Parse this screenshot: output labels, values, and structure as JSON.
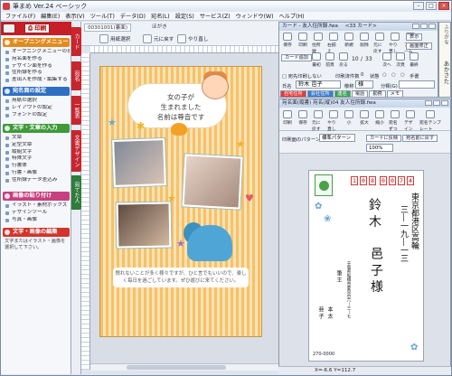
{
  "window": {
    "title": "筆まめ Ver.24 ベーシック"
  },
  "menu": [
    "ファイル(F)",
    "編集(E)",
    "表示(V)",
    "ツール(T)",
    "データ(D)",
    "宛名(L)",
    "設定(S)",
    "サービス(Z)",
    "ウィンドウ(W)",
    "ヘルプ(H)"
  ],
  "left": {
    "print_label": "印刷",
    "sections": [
      {
        "title": "オープニングメニュー",
        "items": [
          "オープニングメニューの表示",
          "宛名面を作る",
          "デザイン面を作る",
          "住所録を作る",
          "差出人を作成・編集する"
        ]
      },
      {
        "title": "宛名面の設定",
        "items": [
          "用紙の選択",
          "レイアウトの設定",
          "フォントの設定"
        ]
      },
      {
        "title": "文字・文章の入力",
        "items": [
          "文章",
          "定型文章",
          "縦組文字",
          "特殊文字",
          "行書体",
          "行書・画像",
          "住所録データ差込み"
        ]
      },
      {
        "title": "画像の貼り付け",
        "items": [
          "イラスト・素材ボックス",
          "デザインツール",
          "写真・画像"
        ]
      },
      {
        "title": "文字・画像の編集",
        "items": []
      }
    ],
    "note": "文字またはイラスト・画像を選択して下さい。"
  },
  "vtabs": [
    "カード",
    "宛名",
    "一覧表",
    "文書デザイン",
    "宛てた人"
  ],
  "doc": {
    "tab1": "00301001(裏面)",
    "tab2": "ほがき",
    "btn_paper": "用紙選択",
    "btn_undo": "元に戻す",
    "btn_redo": "やり直し",
    "card_text": "女の子が\n生まれました\n名前は尊音です",
    "bottom_text": "慣れないことが多く様々ですが、ひと言でもいいので、楽しく毎日を過ごしています。ぜひ遊びに来てください。"
  },
  "cardwin": {
    "title": "カード - 友人住所録.fwa",
    "count_label": "<33 カード>",
    "index": "10",
    "total": "33",
    "top_row": [
      "保存",
      "印刷",
      "住所録",
      "右揃え",
      "新規",
      "削除",
      "元に戻す",
      "やり直し",
      "フォーム"
    ],
    "nav_row": [
      "最初",
      "前頁",
      "戻る",
      "次へ",
      "次頁",
      "最終"
    ],
    "btn_add": "カード追加",
    "btn_display": "表示",
    "btn_fix": "画面修正",
    "print_toggle": "宛先印刷しない",
    "printed_label": "印刷済件数",
    "printed_value": "0",
    "state_label": "状態",
    "state_options": [
      "○",
      "○",
      "○",
      "手書"
    ],
    "name_label": "氏名",
    "name_value": "鈴木 邑子",
    "honorific_label": "敬称",
    "honorific_value": "様",
    "group_label": "分類(G)",
    "furigana_label": "ふりがな",
    "furigana_value": "あかさた",
    "tabs": [
      "自宅住所",
      "会社住所",
      "連名",
      "電話",
      "勤務",
      "電話メモ",
      "メモ",
      "画像",
      "その他"
    ]
  },
  "addrwin": {
    "title": "宛名面(縦書) 宛名(縦)04  友人住所録.fwa",
    "toolbar": [
      "印刷",
      "保存",
      "元に戻す",
      "やり直し",
      "小",
      "拡大",
      "縮小",
      "宛名ずつ",
      "デザイン",
      "宛名テンプレート"
    ],
    "pattern_label": "印刷面のパターン",
    "pattern_value": "標準パターン",
    "zoom_value": "100%",
    "btn_card": "カードに反映",
    "btn_toggle": "宛名前に戻す",
    "zip": [
      "1",
      "0",
      "8",
      "0",
      "0",
      "7",
      "4"
    ],
    "recipient_address": "東京都港区高輪",
    "recipient_address2": "三―一九―一三",
    "recipient_family": "鈴 木",
    "recipient_given": "邑 子 様",
    "sender_address": "千葉県船橋市夏見台六―三―七",
    "sender_name": "筆 王",
    "sender_name2": "本 太",
    "sender_name3": "亜 子",
    "sender_zip": "270-0000"
  },
  "status": {
    "coords": "X=-6.6 Y=112.7"
  }
}
